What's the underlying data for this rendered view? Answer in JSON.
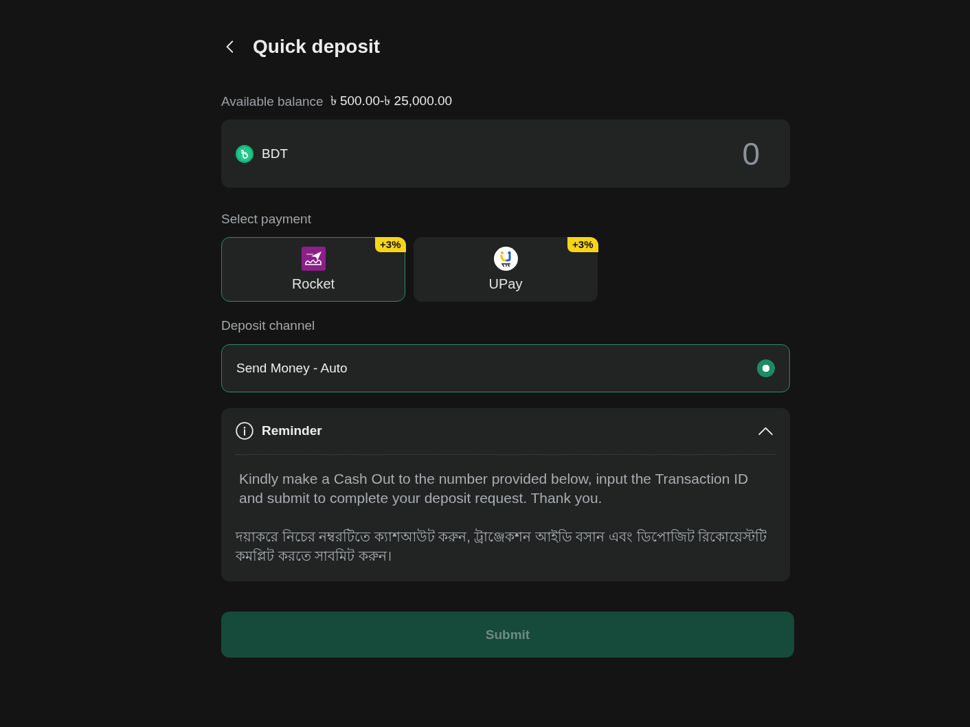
{
  "header": {
    "title": "Quick deposit"
  },
  "balance": {
    "label": "Available balance",
    "value": "৳ 500.00-৳ 25,000.00"
  },
  "amount": {
    "currency": "BDT",
    "placeholder": "0"
  },
  "payment": {
    "label": "Select payment",
    "methods": [
      {
        "name": "Rocket",
        "kind": "rocket",
        "bonus": "+3%",
        "selected": true
      },
      {
        "name": "UPay",
        "kind": "upay",
        "bonus": "+3%",
        "selected": false
      }
    ]
  },
  "channel": {
    "label": "Deposit channel",
    "options": [
      {
        "name": "Send Money - Auto",
        "selected": true
      }
    ]
  },
  "reminder": {
    "title": "Reminder",
    "expanded": true,
    "paragraphs": [
      "Kindly make a Cash Out to the number provided below, input the Transaction ID and submit to complete your deposit request. Thank you.",
      "দয়াকরে নিচের নম্বরটিতে ক্যাশআউট করুন, ট্রাঞ্জেকশন আইডি বসান এবং ডিপোজিট রিকোয়েস্টটি কমপ্লিট করতে সাবমিট করুন।"
    ]
  },
  "submit": {
    "label": "Submit",
    "disabled": true
  }
}
